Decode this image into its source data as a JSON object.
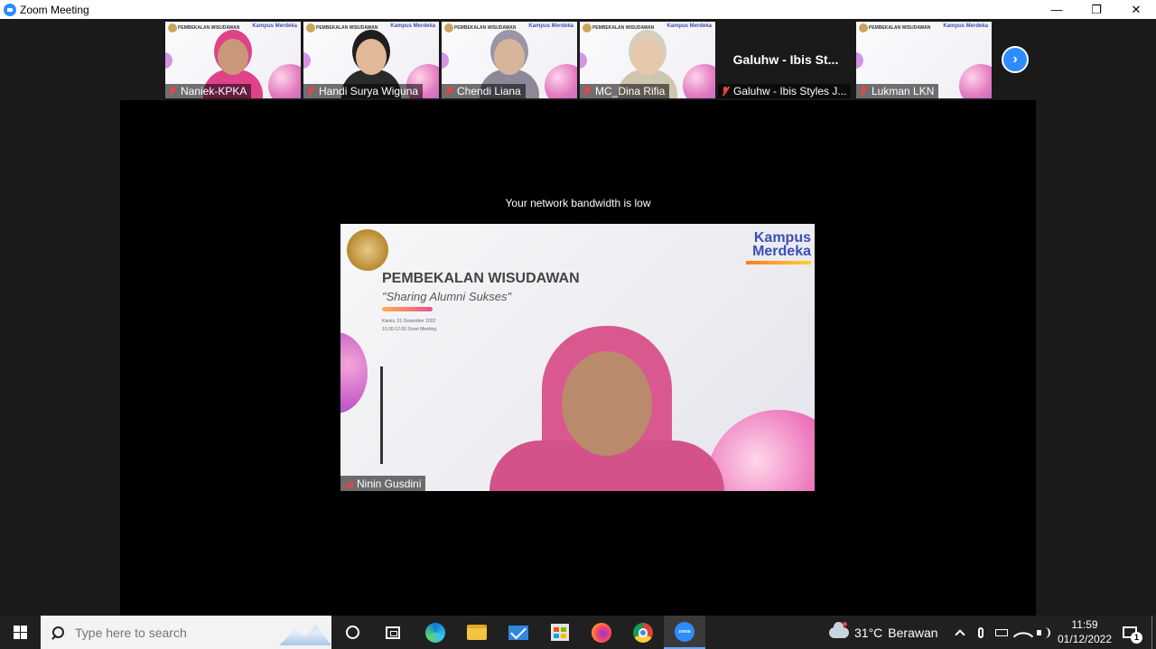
{
  "window": {
    "title": "Zoom Meeting",
    "minimize": "—",
    "restore": "❐",
    "close": "✕"
  },
  "thumbnails": [
    {
      "name": "Naniek-KPKA",
      "kind": "video",
      "skin": "#c89878",
      "cloth": "#e0428a",
      "head": "#e0428a"
    },
    {
      "name": "Handi Surya Wiguna",
      "kind": "video",
      "skin": "#e1b898",
      "cloth": "#2a2a2a",
      "head": "#1e1e1e"
    },
    {
      "name": "Chendi Liana",
      "kind": "video",
      "skin": "#d8b49a",
      "cloth": "#8c8898",
      "head": "#9a96a8"
    },
    {
      "name": "MC_Dina Rifia",
      "kind": "video",
      "skin": "#e8c8ac",
      "cloth": "#cfc6b0",
      "head": "#d6cfba"
    },
    {
      "name": "Galuhw - Ibis Styles J...",
      "kind": "name",
      "big_name": "Galuhw - Ibis St..."
    },
    {
      "name": "Lukman LKN",
      "kind": "slide"
    }
  ],
  "slide_thumb": {
    "heading": "PEMBEKALAN WISUDAWAN",
    "kampus": "Kampus Merdeka"
  },
  "main": {
    "notice": "Your network bandwidth is low",
    "speaker_name": "Ninin Gusdini",
    "slide": {
      "brand": "Kampus Merdeka",
      "heading": "PEMBEKALAN WISUDAWAN",
      "subheading": "\"Sharing Alumni Sukses\"",
      "date_line1": "Kamis, 01 Desember 2022",
      "date_line2": "10.00-12.00 Zoom Meeting"
    }
  },
  "taskbar": {
    "search_placeholder": "Type here to search",
    "apps": [
      "cortana",
      "task-view",
      "edge",
      "file-explorer",
      "mail",
      "store",
      "firefox",
      "chrome",
      "zoom"
    ],
    "zoom_label": "zoom",
    "weather": {
      "temp": "31°C",
      "condition": "Berawan"
    },
    "time": "11:59",
    "date": "01/12/2022",
    "notifications": "1"
  }
}
